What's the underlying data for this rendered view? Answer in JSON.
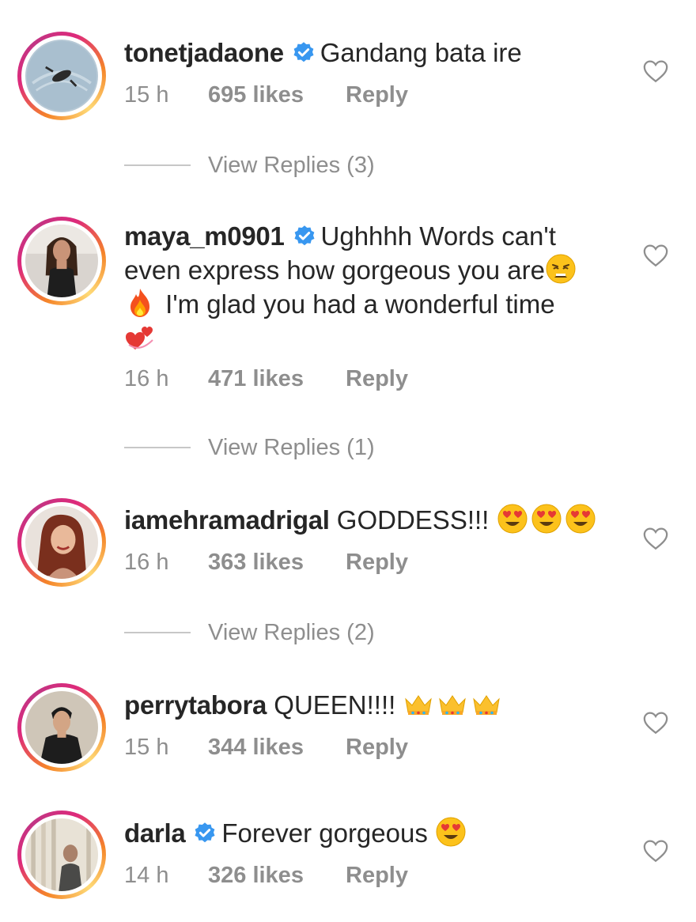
{
  "comments": [
    {
      "username": "tonetjadaone",
      "verified": true,
      "text": "Gandang bata ire",
      "emojis": [],
      "time": "15 h",
      "likes": "695 likes",
      "reply_label": "Reply",
      "view_replies": "View Replies (3)"
    },
    {
      "username": "maya_m0901",
      "verified": true,
      "text_line1": "Ughhhh Words can't",
      "text_line2": "even express how gorgeous you are",
      "text_line3": " I'm glad you had a wonderful time",
      "emojis": [
        "weary-face",
        "fire",
        "revolving-hearts"
      ],
      "time": "16 h",
      "likes": "471 likes",
      "reply_label": "Reply",
      "view_replies": "View Replies (1)"
    },
    {
      "username": "iamehramadrigal",
      "verified": false,
      "text": "GODDESS!!!",
      "emojis": [
        "heart-eyes",
        "heart-eyes",
        "heart-eyes"
      ],
      "time": "16 h",
      "likes": "363 likes",
      "reply_label": "Reply",
      "view_replies": "View Replies (2)"
    },
    {
      "username": "perrytabora",
      "verified": false,
      "text": "QUEEN!!!!",
      "emojis": [
        "crown",
        "crown",
        "crown"
      ],
      "time": "15 h",
      "likes": "344 likes",
      "reply_label": "Reply"
    },
    {
      "username": "darla",
      "verified": true,
      "text": "Forever gorgeous",
      "emojis": [
        "heart-eyes"
      ],
      "time": "14 h",
      "likes": "326 likes",
      "reply_label": "Reply"
    }
  ],
  "colors": {
    "text": "#262626",
    "meta": "#8e8e8e",
    "verified": "#3897f0",
    "ring_start": "#f58529",
    "ring_end": "#dd2a7b"
  },
  "icons": {
    "like": "heart-outline-icon",
    "verified": "verified-badge-icon"
  }
}
